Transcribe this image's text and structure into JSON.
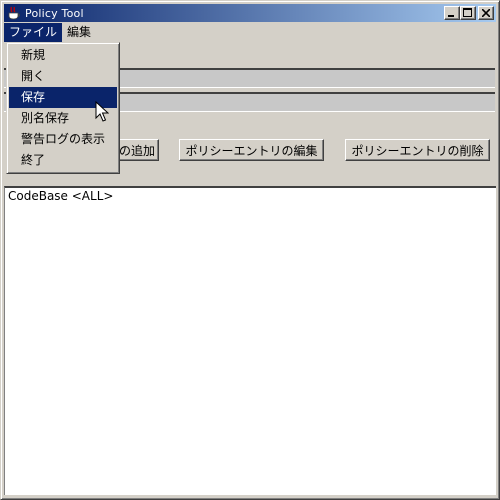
{
  "window": {
    "title": "Policy Tool",
    "icon": "java-cup-icon",
    "controls": [
      "minimize-icon",
      "maximize-icon",
      "close-icon"
    ]
  },
  "menubar": {
    "items": [
      {
        "label": "ファイル",
        "active": true
      },
      {
        "label": "編集",
        "active": false
      }
    ]
  },
  "file_menu": {
    "items": [
      {
        "label": "新規"
      },
      {
        "label": "開く"
      },
      {
        "label": "保存",
        "selected": true
      },
      {
        "label": "別名保存"
      },
      {
        "label": "警告ログの表示"
      },
      {
        "label": "終了"
      }
    ]
  },
  "toolbar": {
    "add_entry_label": "ポリシーエントリの追加",
    "add_entry_visible_text": "の追加",
    "edit_entry_label": "ポリシーエントリの編集",
    "delete_entry_label": "ポリシーエントリの削除"
  },
  "policy_list": {
    "items": [
      "CodeBase <ALL>"
    ]
  },
  "colors": {
    "titlebar_start": "#0a246a",
    "titlebar_end": "#a6caf0",
    "selection": "#0a246a",
    "face": "#d4d0c8"
  }
}
